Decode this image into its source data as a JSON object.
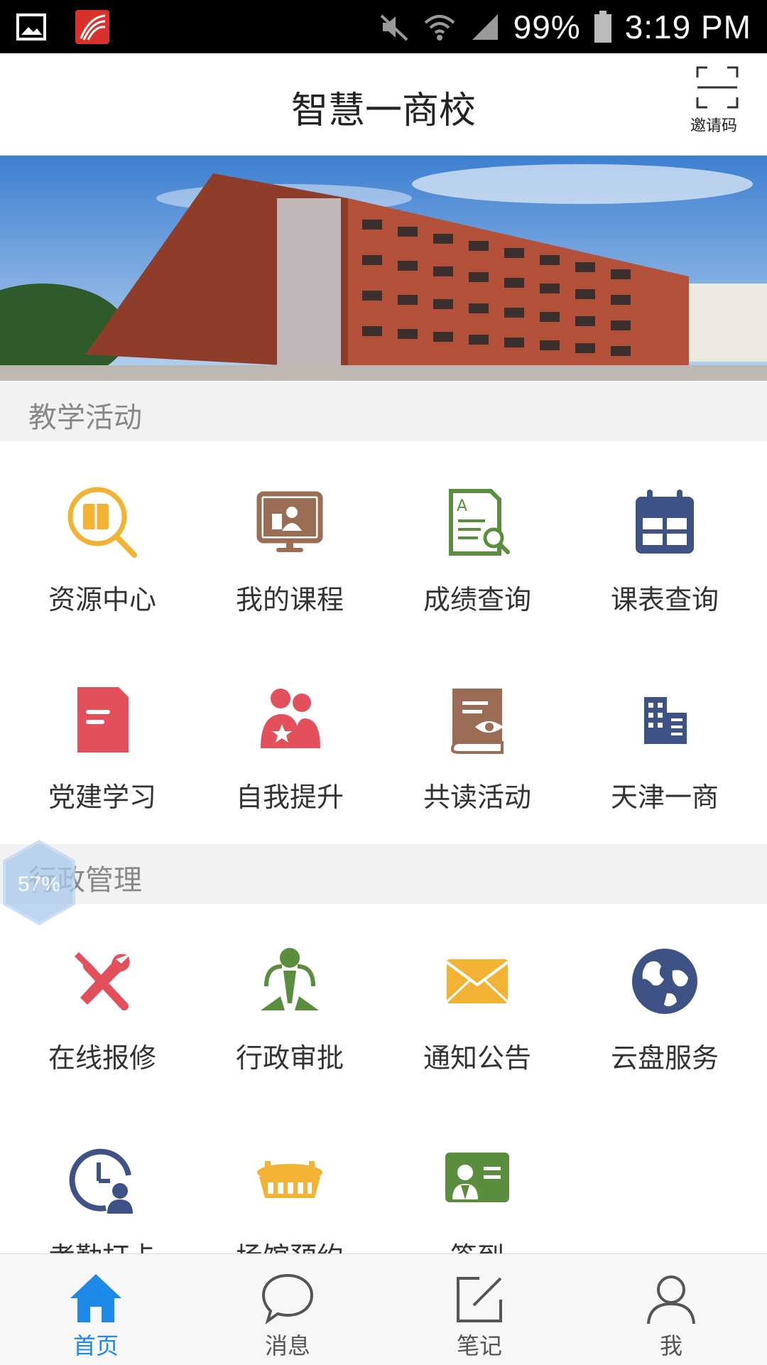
{
  "status_bar": {
    "battery": "99%",
    "time": "3:19 PM"
  },
  "header": {
    "title": "智慧一商校",
    "invite_label": "邀请码"
  },
  "banner": {
    "image": "school-building-photo"
  },
  "sections": [
    {
      "title": "教学活动",
      "items": [
        {
          "label": "资源中心",
          "icon": "resource-search-icon",
          "color": "#f2b233"
        },
        {
          "label": "我的课程",
          "icon": "presentation-icon",
          "color": "#9b6d55"
        },
        {
          "label": "成绩查询",
          "icon": "score-document-icon",
          "color": "#5b8d3f"
        },
        {
          "label": "课表查询",
          "icon": "calendar-icon",
          "color": "#3f5286"
        },
        {
          "label": "党建学习",
          "icon": "document-icon",
          "color": "#e3505b"
        },
        {
          "label": "自我提升",
          "icon": "people-star-icon",
          "color": "#e3505b"
        },
        {
          "label": "共读活动",
          "icon": "book-eye-icon",
          "color": "#9b6d55"
        },
        {
          "label": "天津一商",
          "icon": "buildings-icon",
          "color": "#3f5286"
        }
      ]
    },
    {
      "title": "行政管理",
      "items": [
        {
          "label": "在线报修",
          "icon": "tools-icon",
          "color": "#e3505b"
        },
        {
          "label": "行政审批",
          "icon": "approval-person-icon",
          "color": "#5b8d3f"
        },
        {
          "label": "通知公告",
          "icon": "envelope-icon",
          "color": "#f2b233"
        },
        {
          "label": "云盘服务",
          "icon": "globe-icon",
          "color": "#3f5286"
        },
        {
          "label": "考勤打卡",
          "icon": "clock-person-icon",
          "color": "#3f5286"
        },
        {
          "label": "场馆预约",
          "icon": "stadium-icon",
          "color": "#f2b233"
        },
        {
          "label": "签到",
          "icon": "id-card-icon",
          "color": "#5b8d3f"
        }
      ]
    }
  ],
  "floating_badge": {
    "text": "57%"
  },
  "tabbar": [
    {
      "label": "首页",
      "icon": "home-icon",
      "active": true
    },
    {
      "label": "消息",
      "icon": "chat-bubble-icon",
      "active": false
    },
    {
      "label": "笔记",
      "icon": "edit-note-icon",
      "active": false
    },
    {
      "label": "我",
      "icon": "user-icon",
      "active": false
    }
  ],
  "colors": {
    "accent": "#1e8ae8",
    "section_bg": "#f2f2f4",
    "status_bar": "#000000"
  }
}
